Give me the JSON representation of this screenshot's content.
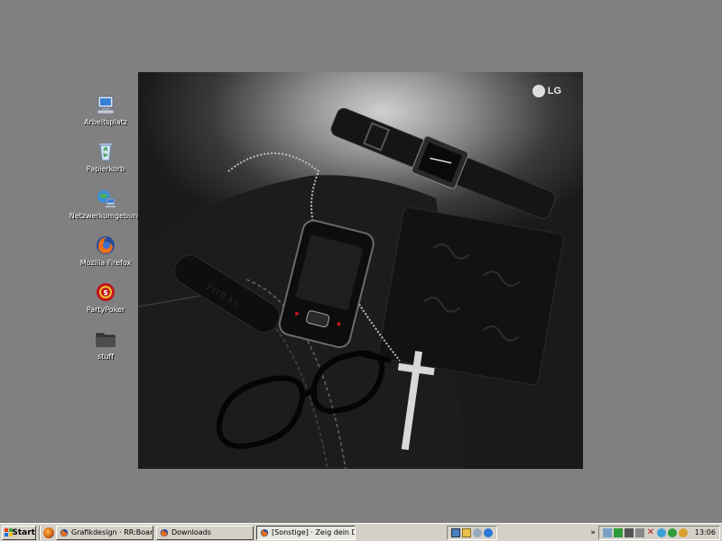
{
  "desktop": {
    "icons": [
      {
        "label": "Arbeitsplatz",
        "icon": "my-computer-icon"
      },
      {
        "label": "Papierkorb",
        "icon": "recycle-bin-icon"
      },
      {
        "label": "Netzwerkumgebung",
        "icon": "network-places-icon"
      },
      {
        "label": "Mozilla Firefox",
        "icon": "firefox-icon"
      },
      {
        "label": "PartyPoker",
        "icon": "partypoker-icon"
      },
      {
        "label": "stuff",
        "icon": "folder-icon"
      }
    ],
    "wallpaper": {
      "logo_text": "LG",
      "strap_text": "TOBAL"
    }
  },
  "taskbar": {
    "start_label": "Start",
    "tasks": [
      {
        "label": "Grafikdesign · RR:Board · ...",
        "icon": "firefox-icon",
        "active": false
      },
      {
        "label": "Downloads",
        "icon": "firefox-icon",
        "active": false
      },
      {
        "label": "[Sonstige] · Zeig dein Des...",
        "icon": "firefox-icon",
        "active": true
      }
    ],
    "tray_expand": "»",
    "clock": "13:06"
  },
  "colors": {
    "desktop_bg": "#808080",
    "taskbar_bg": "#d4d0c8"
  }
}
